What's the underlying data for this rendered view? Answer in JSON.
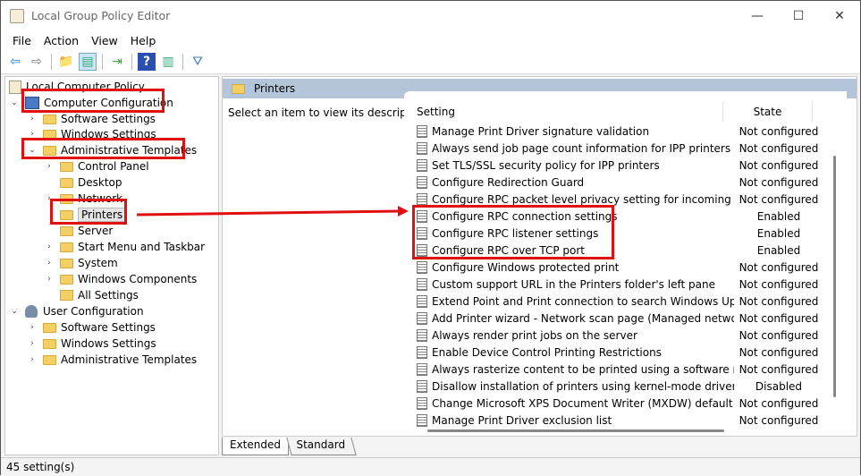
{
  "window": {
    "title": "Local Group Policy Editor",
    "minimize": "—",
    "maximize": "☐",
    "close": "✕"
  },
  "menu": [
    "File",
    "Action",
    "View",
    "Help"
  ],
  "toolbar": [
    {
      "name": "back-icon",
      "g": "⇦",
      "c": "#2a7fd4"
    },
    {
      "name": "forward-icon",
      "g": "⇨",
      "c": "#777"
    },
    {
      "sep": true
    },
    {
      "name": "up-folder-icon",
      "g": "📁",
      "c": "#c90"
    },
    {
      "name": "show-hide-tree-icon",
      "g": "▤",
      "c": "#3a7",
      "sel": true
    },
    {
      "sep": true
    },
    {
      "name": "export-list-icon",
      "g": "⇥",
      "c": "#3a3"
    },
    {
      "sep": true
    },
    {
      "name": "help-icon",
      "g": "?",
      "c": "#fff",
      "bg": "#2b4fb0"
    },
    {
      "name": "properties-icon",
      "g": "▥",
      "c": "#3a7"
    },
    {
      "sep": true
    },
    {
      "name": "filter-icon",
      "g": "⛛",
      "c": "#3a7ab8"
    }
  ],
  "tree": [
    {
      "label": "Local Computer Policy",
      "level": 0,
      "icon": "scroll",
      "chev": ""
    },
    {
      "label": "Computer Configuration",
      "level": 0,
      "icon": "cfg",
      "chev": "⌄"
    },
    {
      "label": "Software Settings",
      "level": 1,
      "icon": "folder",
      "chev": "›"
    },
    {
      "label": "Windows Settings",
      "level": 1,
      "icon": "folder",
      "chev": "›"
    },
    {
      "label": "Administrative Templates",
      "level": 1,
      "icon": "folder",
      "chev": "⌄"
    },
    {
      "label": "Control Panel",
      "level": 2,
      "icon": "folder",
      "chev": "›"
    },
    {
      "label": "Desktop",
      "level": 2,
      "icon": "folder",
      "chev": ""
    },
    {
      "label": "Network",
      "level": 2,
      "icon": "folder",
      "chev": "›"
    },
    {
      "label": "Printers",
      "level": 2,
      "icon": "folder",
      "chev": "",
      "selected": true
    },
    {
      "label": "Server",
      "level": 2,
      "icon": "folder",
      "chev": ""
    },
    {
      "label": "Start Menu and Taskbar",
      "level": 2,
      "icon": "folder",
      "chev": "›"
    },
    {
      "label": "System",
      "level": 2,
      "icon": "folder",
      "chev": "›"
    },
    {
      "label": "Windows Components",
      "level": 2,
      "icon": "folder",
      "chev": "›"
    },
    {
      "label": "All Settings",
      "level": 2,
      "icon": "gearfolder",
      "chev": ""
    },
    {
      "label": "User Configuration",
      "level": 0,
      "icon": "user",
      "chev": "⌄"
    },
    {
      "label": "Software Settings",
      "level": 1,
      "icon": "folder",
      "chev": "›"
    },
    {
      "label": "Windows Settings",
      "level": 1,
      "icon": "folder",
      "chev": "›"
    },
    {
      "label": "Administrative Templates",
      "level": 1,
      "icon": "folder",
      "chev": "›"
    }
  ],
  "pane": {
    "title": "Printers",
    "description": "Select an item to view its description.",
    "col_setting": "Setting",
    "col_state": "State"
  },
  "settings": [
    {
      "name": "Manage Print Driver signature validation",
      "state": "Not configured"
    },
    {
      "name": "Always send job page count information for IPP printers",
      "state": "Not configured"
    },
    {
      "name": "Set TLS/SSL security policy for IPP printers",
      "state": "Not configured"
    },
    {
      "name": "Configure Redirection Guard",
      "state": "Not configured"
    },
    {
      "name": "Configure RPC packet level privacy setting for incoming co...",
      "state": "Not configured"
    },
    {
      "name": "Configure RPC connection settings",
      "state": "Enabled"
    },
    {
      "name": "Configure RPC listener settings",
      "state": "Enabled"
    },
    {
      "name": "Configure RPC over TCP port",
      "state": "Enabled"
    },
    {
      "name": "Configure Windows protected print",
      "state": "Not configured"
    },
    {
      "name": "Custom support URL in the Printers folder's left pane",
      "state": "Not configured"
    },
    {
      "name": "Extend Point and Print connection to search Windows Update",
      "state": "Not configured"
    },
    {
      "name": "Add Printer wizard - Network scan page (Managed network)",
      "state": "Not configured"
    },
    {
      "name": "Always render print jobs on the server",
      "state": "Not configured"
    },
    {
      "name": "Enable Device Control Printing Restrictions",
      "state": "Not configured"
    },
    {
      "name": "Always rasterize content to be printed using a software raste...",
      "state": "Not configured"
    },
    {
      "name": "Disallow installation of printers using kernel-mode drivers",
      "state": "Disabled"
    },
    {
      "name": "Change Microsoft XPS Document Writer (MXDW) default ou...",
      "state": "Not configured"
    },
    {
      "name": "Manage Print Driver exclusion list",
      "state": "Not configured"
    }
  ],
  "tabs": [
    "Extended",
    "Standard"
  ],
  "status": "45 setting(s)",
  "annotation_color": "#e01010"
}
